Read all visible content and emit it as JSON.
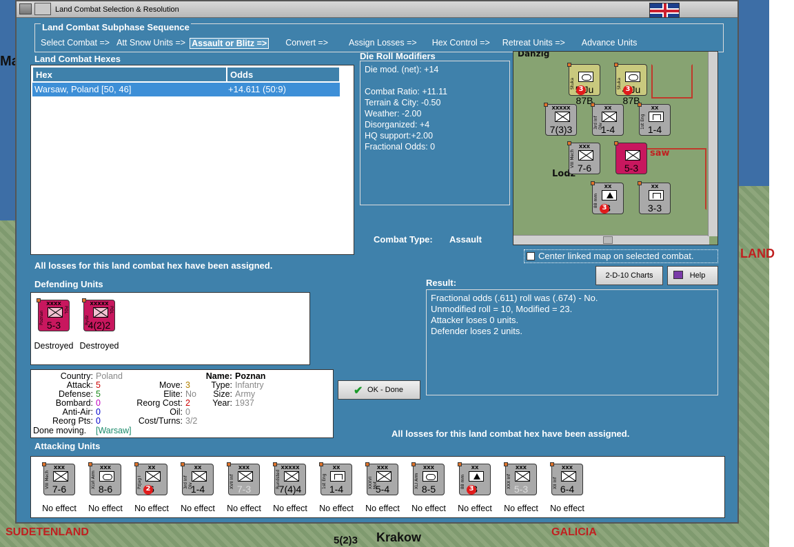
{
  "window": {
    "title": "Land Combat Selection & Resolution"
  },
  "subphase": {
    "title": "Land Combat Subphase Sequence",
    "steps": [
      "Select Combat =>",
      "Att Snow Units =>",
      "Assault or Blitz =>",
      "Convert =>",
      "Assign Losses =>",
      "Hex Control =>",
      "Retreat Units =>",
      "Advance Units"
    ],
    "active_index": 2
  },
  "hexes": {
    "title": "Land Combat Hexes",
    "col_hex": "Hex",
    "col_odds": "Odds",
    "rows": [
      {
        "hex": "Warsaw, Poland [50, 46]",
        "odds": "+14.611 (50:9)"
      }
    ]
  },
  "drm": {
    "title": "Die Roll Modifiers",
    "lines": [
      "Die mod. (net): +14",
      "",
      "Combat Ratio: +11.11",
      "Terrain & City: -0.50",
      "Weather: -2.00",
      "Disorganized: +4",
      "HQ support:+2.00",
      "Fractional Odds: 0"
    ]
  },
  "combat_type": {
    "label": "Combat Type:",
    "value": "Assault"
  },
  "center_linked": {
    "label": "Center linked map on selected combat.",
    "checked": false
  },
  "losses_msg": "All losses for this land combat hex have been assigned.",
  "losses_msg2": "All losses for this land combat hex have been assigned.",
  "buttons": {
    "charts": "2-D-10 Charts",
    "help": "Help",
    "ok": "OK - Done"
  },
  "result": {
    "title": "Result:",
    "lines": [
      "Fractional odds (.611) roll was (.674)  - No.",
      "Unmodified roll = 10, Modified = 23.",
      "Attacker loses 0 units.",
      "Defender loses 2 units."
    ]
  },
  "defending": {
    "title": "Defending Units",
    "units": [
      {
        "size": "XXXX",
        "name": "Poznan",
        "nat": "POL",
        "value": "5-3",
        "status": "Destroyed"
      },
      {
        "size": "XXXXX",
        "name": "Rydz",
        "nat": "POL",
        "value": "4(2)2",
        "status": "Destroyed"
      }
    ]
  },
  "unit_info": {
    "country_k": "Country:",
    "country_v": "Poland",
    "attack_k": "Attack:",
    "attack_v": "5",
    "defense_k": "Defense:",
    "defense_v": "5",
    "bombard_k": "Bombard:",
    "bombard_v": "0",
    "antiair_k": "Anti-Air:",
    "antiair_v": "0",
    "reorgpts_k": "Reorg Pts:",
    "reorgpts_v": "0",
    "move_k": "Move:",
    "move_v": "3",
    "elite_k": "Elite:",
    "elite_v": "No",
    "reorgcost_k": "Reorg Cost:",
    "reorgcost_v": "2",
    "oil_k": "Oil:",
    "oil_v": "0",
    "costturns_k": "Cost/Turns:",
    "costturns_v": "3/2",
    "name_k": "Name:",
    "name_v": "Poznan",
    "type_k": "Type:",
    "type_v": "Infantry",
    "size_k": "Size:",
    "size_v": "Army",
    "year_k": "Year:",
    "year_v": "1937",
    "done_moving": "Done moving.",
    "location": "[Warsaw]",
    "colors": {
      "attack": "#cc0000",
      "defense": "#1a8a1a",
      "bombard": "#c000c0",
      "antiair": "#0000cc",
      "reorgpts": "#0000cc",
      "move": "#b08000",
      "reorgcost": "#cc0000"
    }
  },
  "attacking": {
    "title": "Attacking Units",
    "units": [
      {
        "size": "XXX",
        "name": "VIII Mech",
        "sym": "cross",
        "value": "7-6",
        "status": "No effect"
      },
      {
        "size": "XXX",
        "name": "XLVI Arm",
        "sym": "oval",
        "value": "8-6",
        "status": "No effect"
      },
      {
        "size": "XX",
        "name": "PzJag I",
        "sym": "cross",
        "value": "6",
        "badge": "2",
        "status": "No effect"
      },
      {
        "size": "XX",
        "name": "3rd Inf Div",
        "sym": "cross",
        "value": "1-4",
        "status": "No effect"
      },
      {
        "size": "XXX",
        "name": "XVII Inf",
        "sym": "cross",
        "value": "7-3",
        "dim": true,
        "status": "No effect"
      },
      {
        "size": "XXXXX",
        "name": "Rundstedt",
        "sym": "cross",
        "value": "7(4)4",
        "status": "No effect"
      },
      {
        "size": "XX",
        "name": "1st Eng",
        "sym": "eng",
        "value": "1-4",
        "status": "No effect"
      },
      {
        "size": "XXX",
        "name": "XXXVI Mot",
        "sym": "cross",
        "value": "5-4",
        "status": "No effect"
      },
      {
        "size": "XXX",
        "name": "XLI Arm",
        "sym": "oval",
        "value": "8-5",
        "status": "No effect"
      },
      {
        "size": "XX",
        "name": "88 mm",
        "sym": "tri",
        "value": "3",
        "badge": "3",
        "status": "No effect"
      },
      {
        "size": "XXX",
        "name": "XXX Inf",
        "sym": "cross",
        "value": "5-3",
        "dim": true,
        "status": "No effect"
      },
      {
        "size": "XXX",
        "name": "XII Inf",
        "sym": "cross",
        "value": "6-4",
        "status": "No effect"
      }
    ]
  },
  "minimap": {
    "labels": [
      "Danzig",
      "Lodz",
      "saw"
    ],
    "units": [
      {
        "size": "",
        "name": "Stuka",
        "value": "5 Ju 87B",
        "badge": "3"
      },
      {
        "size": "",
        "name": "Stuka",
        "value": "4 Ju 87B",
        "badge": "3"
      },
      {
        "size": "XXXXX",
        "name": "",
        "value": "7(3)3"
      },
      {
        "size": "XX",
        "name": "3rd Inf Div",
        "value": "1-4"
      },
      {
        "size": "XX",
        "name": "1st Eng",
        "value": "1-4"
      },
      {
        "size": "XXX",
        "name": "VIII Mech",
        "value": "7-6"
      },
      {
        "size": "",
        "name": "",
        "value": "5-3"
      },
      {
        "size": "XX",
        "name": "88 mm",
        "value": "3",
        "badge": "3"
      },
      {
        "size": "XX",
        "name": "",
        "value": "3-3"
      }
    ]
  },
  "background": {
    "labels": [
      "Ma",
      "LAND",
      "SUDETENLAND",
      "Krakow",
      "GALICIA",
      "5(2)3"
    ]
  }
}
